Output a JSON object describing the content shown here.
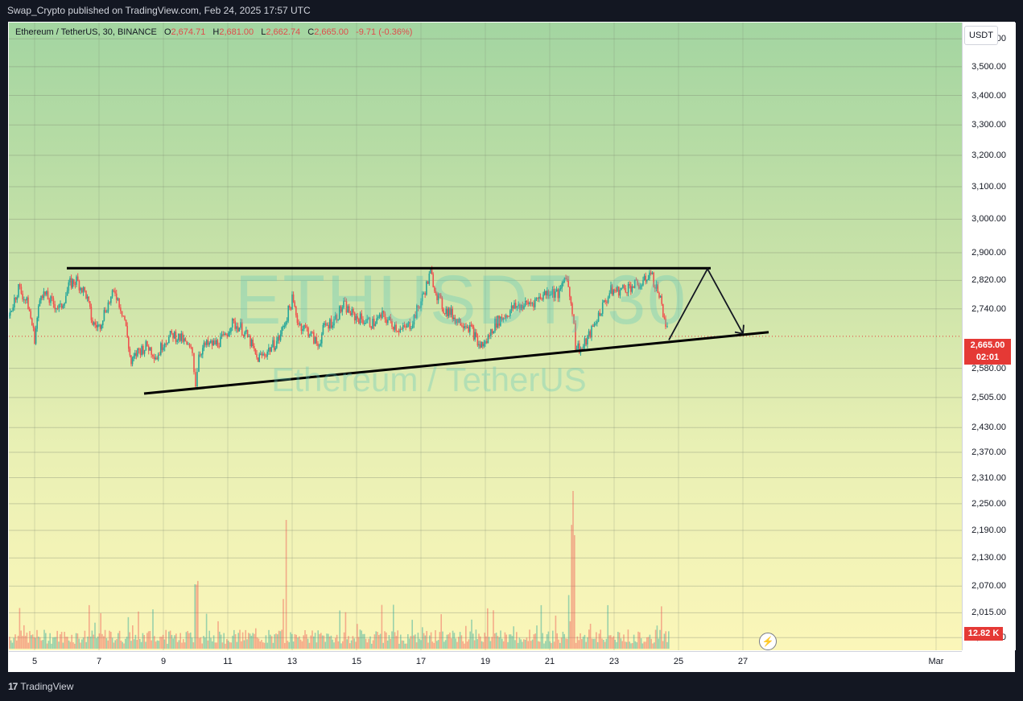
{
  "header": {
    "published": "Swap_Crypto published on TradingView.com, Feb 24, 2025 17:57 UTC"
  },
  "legend": {
    "symbol": "Ethereum / TetherUS, 30, BINANCE",
    "o_label": "O",
    "open": "2,674.71",
    "h_label": "H",
    "high": "2,681.00",
    "l_label": "L",
    "low": "2,662.74",
    "c_label": "C",
    "close": "2,665.00",
    "change": "-9.71 (-0.36%)"
  },
  "watermark": {
    "ticker": "ETHUSDT, 30",
    "name": "Ethereum / TetherUS"
  },
  "axis": {
    "currency": "USDT"
  },
  "price_tag": {
    "price": "2,665.00",
    "countdown": "02:01"
  },
  "volume_tag": {
    "value": "12.82 K"
  },
  "footer": {
    "brand": "TradingView",
    "logo": "17"
  },
  "colors": {
    "up": "#26a69a",
    "down": "#ef5350",
    "line": "#000000",
    "current": "#e53935"
  },
  "chart_data": {
    "type": "line",
    "scale": "log",
    "ylim": [
      1940,
      3660
    ],
    "yticks": [
      "3,600.00",
      "3,500.00",
      "3,400.00",
      "3,300.00",
      "3,200.00",
      "3,100.00",
      "3,000.00",
      "2,900.00",
      "2,820.00",
      "2,740.00",
      "2,580.00",
      "2,505.00",
      "2,430.00",
      "2,370.00",
      "2,310.00",
      "2,250.00",
      "2,190.00",
      "2,130.00",
      "2,070.00",
      "2,015.00",
      "1,965.00"
    ],
    "xticks": [
      "5",
      "7",
      "9",
      "11",
      "13",
      "15",
      "17",
      "19",
      "21",
      "23",
      "25",
      "27",
      "Mar"
    ],
    "xrange": [
      4.2,
      33.8
    ],
    "series": [
      {
        "x": [
          4.2,
          4.5,
          4.8,
          5.0,
          5.2,
          5.5,
          5.8,
          6.1,
          6.3,
          6.6,
          6.8,
          7.0,
          7.2,
          7.5,
          7.8,
          8.0,
          8.2,
          8.5,
          8.8,
          9.0,
          9.3,
          9.6,
          9.9,
          10.0,
          10.1,
          10.3,
          10.6,
          10.9,
          11.1,
          11.4,
          11.7,
          11.9,
          12.1,
          12.4,
          12.6,
          12.8,
          13.0,
          13.2,
          13.5,
          13.8,
          14.0,
          14.3,
          14.6,
          14.9,
          15.2,
          15.5,
          15.8,
          16.1,
          16.4,
          16.7,
          17.0,
          17.3,
          17.5,
          17.7,
          17.9,
          18.1,
          18.4,
          18.6,
          18.8,
          19.0,
          19.3,
          19.6,
          19.9,
          20.2,
          20.5,
          20.8,
          21.0,
          21.3,
          21.5,
          21.7,
          21.8,
          22.0,
          22.3,
          22.6,
          22.9,
          23.1,
          23.4,
          23.6,
          23.9,
          24.1,
          24.4,
          24.6,
          24.7
        ],
        "y": [
          2720,
          2800,
          2750,
          2660,
          2790,
          2760,
          2740,
          2810,
          2820,
          2780,
          2700,
          2690,
          2740,
          2790,
          2710,
          2590,
          2625,
          2640,
          2610,
          2650,
          2670,
          2655,
          2620,
          2540,
          2620,
          2640,
          2645,
          2660,
          2700,
          2690,
          2650,
          2605,
          2615,
          2640,
          2660,
          2710,
          2765,
          2700,
          2680,
          2640,
          2690,
          2710,
          2750,
          2720,
          2710,
          2700,
          2720,
          2700,
          2680,
          2700,
          2760,
          2840,
          2780,
          2740,
          2730,
          2710,
          2700,
          2680,
          2640,
          2645,
          2700,
          2720,
          2745,
          2750,
          2760,
          2780,
          2790,
          2780,
          2840,
          2740,
          2640,
          2630,
          2680,
          2740,
          2790,
          2790,
          2800,
          2805,
          2810,
          2845,
          2780,
          2700,
          2665
        ]
      }
    ],
    "volume": {
      "peaks": [
        {
          "x": 21.7,
          "v": 12.82
        }
      ],
      "label": "12.82 K"
    },
    "annotations": [
      {
        "type": "resistance",
        "from": [
          6.0,
          2855
        ],
        "to": [
          26.0,
          2855
        ]
      },
      {
        "type": "support",
        "from": [
          8.4,
          2515
        ],
        "to": [
          27.8,
          2676
        ]
      },
      {
        "type": "projection",
        "points": [
          [
            24.7,
            2655
          ],
          [
            25.9,
            2853
          ],
          [
            27.0,
            2672
          ]
        ]
      }
    ]
  }
}
